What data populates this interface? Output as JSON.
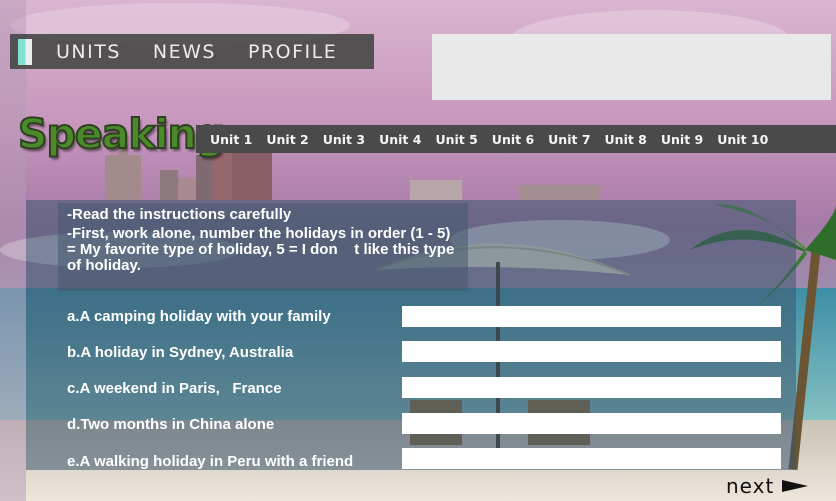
{
  "nav": {
    "items": [
      {
        "label": "UNITS"
      },
      {
        "label": "NEWS"
      },
      {
        "label": "PROFILE"
      }
    ]
  },
  "section_title": "Speaking",
  "units": [
    "Unit 1",
    "Unit 2",
    "Unit 3",
    "Unit 4",
    "Unit 5",
    "Unit 6",
    "Unit 7",
    "Unit 8",
    "Unit 9",
    "Unit 10"
  ],
  "instructions": {
    "line1": "-Read the instructions carefully",
    "line2": "-First, work alone, number the holidays in order (1 - 5) = My favorite type of holiday, 5 = I don    t like this type of holiday."
  },
  "questions": [
    {
      "label": "a.A camping holiday with your family",
      "value": ""
    },
    {
      "label": "b.A holiday in Sydney, Australia",
      "value": ""
    },
    {
      "label": "c.A weekend in Paris,   France",
      "value": ""
    },
    {
      "label": "d.Two months in China alone",
      "value": ""
    },
    {
      "label": "e.A walking holiday in Peru with a friend",
      "value": ""
    }
  ],
  "next_label": "next",
  "colors": {
    "nav_bg": "#4a4a4a",
    "speaking_green": "#4a8a2a",
    "panel_blue": "#3c556e"
  },
  "icons": {
    "logo": "logo-icon",
    "next": "arrow-right-icon"
  }
}
